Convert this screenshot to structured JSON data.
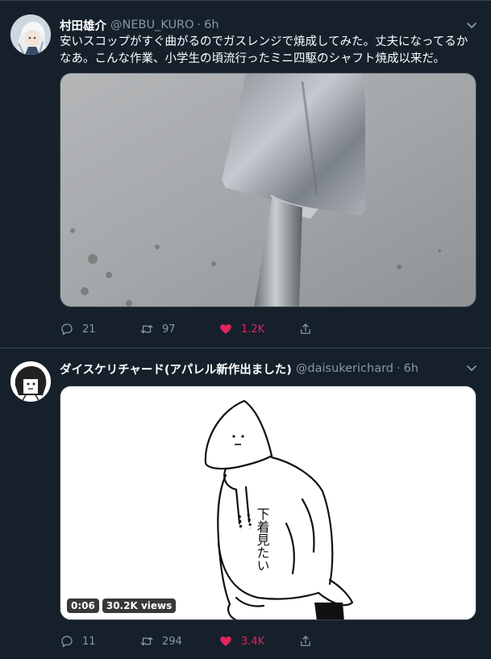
{
  "tweets": [
    {
      "display_name": "村田雄介",
      "handle": "@NEBU_KURO",
      "separator": "·",
      "time": "6h",
      "text": "安いスコップがすぐ曲がるのでガスレンジで焼成してみた。丈夫になってるかなあ。こんな作業、小学生の頃流行ったミニ四駆のシャフト焼成以来だ。",
      "media_type": "photo",
      "replies": "21",
      "retweets": "97",
      "likes": "1.2K",
      "liked": true
    },
    {
      "display_name": "ダイスケリチャード(アパレル新作出ました)",
      "handle": "@daisukerichard",
      "separator": "·",
      "time": "6h",
      "text": "",
      "media_type": "video",
      "video_duration": "0:06",
      "video_views": "30.2K views",
      "drawing_text": "下着見たい",
      "replies": "11",
      "retweets": "294",
      "likes": "3.4K",
      "liked": true
    }
  ],
  "icons": {
    "reply": "reply-icon",
    "retweet": "retweet-icon",
    "like": "heart-icon",
    "share": "share-icon",
    "caret": "chevron-down-icon"
  },
  "colors": {
    "background": "#15202b",
    "border": "#38444d",
    "secondary_text": "#8899a6",
    "like": "#e0245e"
  }
}
